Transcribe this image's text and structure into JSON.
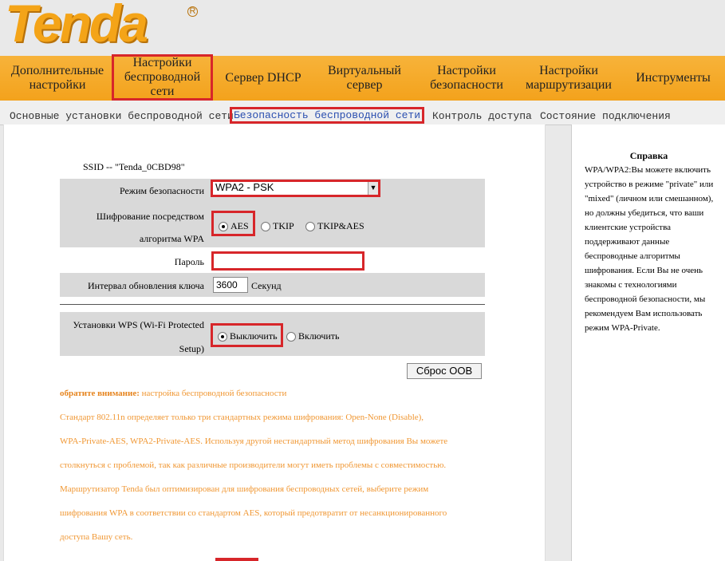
{
  "logo": {
    "text": "Tenda",
    "reg": "R"
  },
  "main_nav": [
    {
      "l1": "Дополнительные",
      "l2": "настройки"
    },
    {
      "l1": "Настройки",
      "l2": "беспроводной",
      "l3": "сети"
    },
    {
      "l1": "Сервер DHCP"
    },
    {
      "l1": "Виртуальный",
      "l2": "сервер"
    },
    {
      "l1": "Настройки",
      "l2": "безопасности"
    },
    {
      "l1": "Настройки",
      "l2": "маршрутизации"
    },
    {
      "l1": "Инструменты"
    }
  ],
  "sub_nav": [
    "Основные установки беспроводной сети",
    "Безопасность беспроводной сети",
    "Контроль доступа",
    "Состояние подключения"
  ],
  "form": {
    "ssid": "SSID -- \"Tenda_0CBD98\"",
    "security_mode_label": "Режим безопасности",
    "security_mode_value": "WPA2 - PSK",
    "cipher_label_1": "Шифрование посредством",
    "cipher_label_2": "алгоритма WPA",
    "cipher_options": [
      "AES",
      "TKIP",
      "TKIP&AES"
    ],
    "password_label": "Пароль",
    "password_value": "",
    "interval_label": "Интервал обновления ключа",
    "interval_value": "3600",
    "interval_unit": "Секунд",
    "wps_label_1": "Установки WPS (Wi-Fi Protected",
    "wps_label_2": "Setup)",
    "wps_options": [
      "Выключить",
      "Включить"
    ],
    "reset_button": "Сброс OOB"
  },
  "notice": {
    "title": "обратите внимание:",
    "title_rest": " настройка беспроводной безопасности",
    "lines": [
      "Стандарт 802.11n определяет только три стандартных режима шифрования: Open-None (Disable),",
      "WPA-Private-AES, WPA2-Private-AES. Используя другой нестандартный метод шифрования Вы можете",
      "столкнуться с проблемой, так как различные производители могут иметь проблемы с совместимостью.",
      "Маршрутизатор Tenda был оптимизирован для шифрования беспроводных сетей, выберите режим",
      "шифрования WPA в соответствии со стандартом AES, который предотвратит от несанкционированного",
      "доступа Вашу сеть."
    ]
  },
  "help": {
    "title": "Справка",
    "text": "WPA/WPA2:Вы можете включить устройство в режиме \"private\" или \"mixed\" (личном или смешанном), но должны убедиться, что ваши клиентские устройства поддерживают данные беспроводные алгоритмы шифрования. Если Вы не очень знакомы с технологиями беспроводной безопасности, мы рекомендуем Вам использовать режим WPA-Private."
  },
  "colors": {
    "accent": "#f3a21c",
    "highlight": "#d7262a",
    "notice": "#f09733",
    "link": "#2a4fb0"
  }
}
